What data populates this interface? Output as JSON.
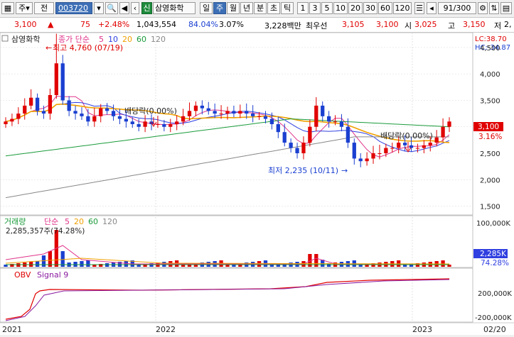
{
  "toolbar": {
    "grid_icon": "grid-icon",
    "market_dropdown": "주",
    "market_scope": "전",
    "stock_code": "003720",
    "stock_name": "삼영화학",
    "credit_badge": "신",
    "periods": [
      "일",
      "주",
      "월",
      "년",
      "분",
      "초",
      "틱"
    ],
    "selected_period": "주",
    "intervals": [
      "1",
      "3",
      "5",
      "10",
      "20",
      "30",
      "60",
      "120"
    ],
    "count": "91/300"
  },
  "infobar": {
    "price": "3,100",
    "change": "75",
    "change_pct": "+2.48%",
    "volume": "1,043,554",
    "volume_ratio": "84.04%",
    "turnover": "3.07%",
    "trade_value": "3,228백만",
    "best_ask_label": "최우선",
    "best_ask": "3,105",
    "best_bid": "3,100",
    "open_label": "시",
    "open": "3,025",
    "high_label": "고",
    "high": "3,150",
    "low_label": "저",
    "low": "2,"
  },
  "price_panel": {
    "legend_name": "삼영화학",
    "legend_ma": "종가 단순",
    "ma_periods": [
      "5",
      "10",
      "20",
      "60",
      "120"
    ],
    "ma_colors": [
      "#e0348a",
      "#2f3fe0",
      "#f0a000",
      "#1a9b3a",
      "#888888"
    ],
    "lc": "LC:38.70",
    "hc": "HC:-34.87",
    "max_annotation": "최고 4,760 (07/19)",
    "min_annotation": "최저 2,235 (10/11)",
    "dividend1": "배당락(0.00%)",
    "dividend2": "배당락(0.00%)",
    "current_price": "3,100",
    "current_pct": "3.16%",
    "y_ticks": [
      "4,500",
      "4,000",
      "3,500",
      "3,000",
      "2,500",
      "2,000",
      "1,500"
    ]
  },
  "volume_panel": {
    "legend": "거래량",
    "legend_ma": "단순",
    "ma_periods": [
      "5",
      "20",
      "60",
      "120"
    ],
    "annotation": "2,285,357주(74.28%)",
    "y_ticks": [
      "100,000K"
    ],
    "current": "2,285K",
    "current_pct": "74.28%"
  },
  "obv_panel": {
    "legend": "OBV",
    "signal": "Signal 9",
    "y_ticks": [
      "200,000K",
      "-200,000K"
    ]
  },
  "x_axis": [
    "2021",
    "2022",
    "2023",
    "02/20"
  ],
  "chart_data": {
    "type": "candlestick",
    "title": "삼영화학",
    "series_weekly_close_approx": [
      3100,
      3150,
      3250,
      3400,
      3550,
      3300,
      3250,
      3600,
      4200,
      3500,
      3300,
      3250,
      3200,
      3100,
      3200,
      3350,
      3300,
      3200,
      3150,
      3100,
      3050,
      3000,
      3100,
      3050,
      3050,
      3000,
      3050,
      3100,
      3200,
      3300,
      3400,
      3350,
      3300,
      3250,
      3250,
      3300,
      3250,
      3300,
      3250,
      3200,
      3200,
      3150,
      3050,
      2900,
      2700,
      2600,
      2500,
      2700,
      3000,
      3400,
      3200,
      3100,
      3100,
      3000,
      2700,
      2400,
      2350,
      2400,
      2500,
      2500,
      2600,
      2600,
      2700,
      2650,
      2600,
      2600,
      2650,
      2700,
      2800,
      3000,
      3100
    ],
    "price_ylim": [
      1400,
      4700
    ],
    "max": {
      "value": 4760,
      "date": "07/19"
    },
    "min": {
      "value": 2235,
      "date": "10/11"
    }
  }
}
